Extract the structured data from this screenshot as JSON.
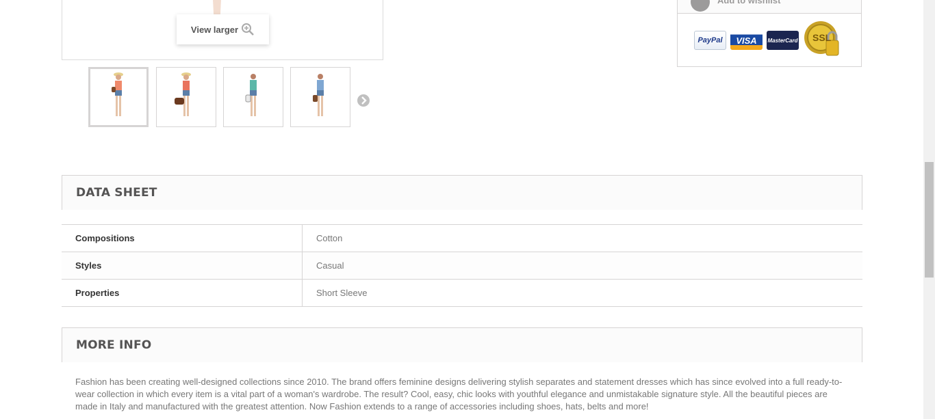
{
  "gallery": {
    "view_larger_label": "View larger",
    "thumbnails": [
      {
        "name": "thumbnail-1",
        "active": true,
        "top_color": "#f08a6c",
        "accessory": "bag"
      },
      {
        "name": "thumbnail-2",
        "active": false,
        "top_color": "#e9735e",
        "accessory": "duffel"
      },
      {
        "name": "thumbnail-3",
        "active": false,
        "top_color": "#5cb7a8",
        "accessory": "tote"
      },
      {
        "name": "thumbnail-4",
        "active": false,
        "top_color": "#7fa7d2",
        "accessory": "bag"
      }
    ]
  },
  "buy_box": {
    "wishlist_label": "Add to wishlist",
    "payment_methods": [
      "PayPal",
      "VISA",
      "MasterCard",
      "SSL"
    ]
  },
  "data_sheet": {
    "title": "DATA SHEET",
    "rows": [
      {
        "key": "Compositions",
        "value": "Cotton"
      },
      {
        "key": "Styles",
        "value": "Casual"
      },
      {
        "key": "Properties",
        "value": "Short Sleeve"
      }
    ]
  },
  "more_info": {
    "title": "MORE INFO",
    "text": "Fashion has been creating well-designed collections since 2010. The brand offers feminine designs delivering stylish separates and statement dresses which has since evolved into a full ready-to-wear collection in which every item is a vital part of a woman's wardrobe. The result? Cool, easy, chic looks with youthful elegance and unmistakable signature style. All the beautiful pieces are made in Italy and manufactured with the greatest attention. Now Fashion extends to a range of accessories including shoes, hats, belts and more!"
  },
  "colors": {
    "border": "#d6d4d4",
    "heading": "#555454",
    "muted_text": "#777777"
  }
}
